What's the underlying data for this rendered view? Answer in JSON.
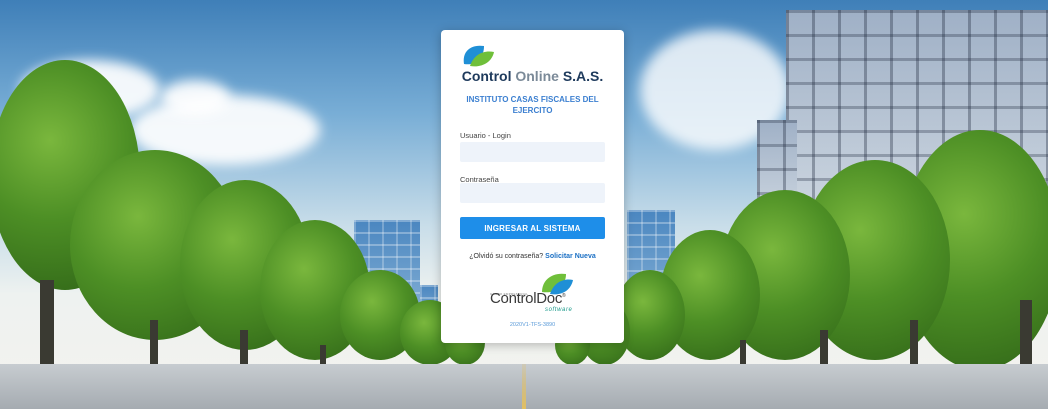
{
  "brand": {
    "name_part1": "Control",
    "name_part2": "Online",
    "name_part3": "S.A.S."
  },
  "institution": "INSTITUTO CASAS FISCALES DEL EJERCITO",
  "login": {
    "username_label": "Usuario - Login",
    "username_value": "",
    "password_label": "Contraseña",
    "password_value": "",
    "submit_label": "INGRESAR AL SISTEMA"
  },
  "forgot": {
    "question": "¿Olvidó su contraseña?",
    "link_label": "Solicitar Nueva"
  },
  "footer_logo": {
    "small_text": "GRUPO EMPRESARIAL",
    "name": "ControlDoc",
    "reg": "®",
    "subtitle": "software"
  },
  "version": "2020V1-TFS-3890",
  "colors": {
    "accent": "#1e8ee9",
    "brand_dark": "#1e3a5c",
    "institute": "#3b7fd0",
    "logo_green": "#6fbf3a",
    "logo_blue": "#1f8fd6"
  },
  "icons": {
    "brand_logo": "leaf-logo-icon",
    "controldoc_logo": "leaf-logo-icon"
  }
}
